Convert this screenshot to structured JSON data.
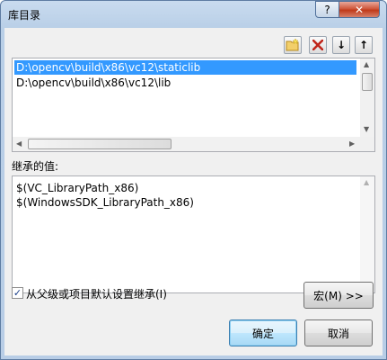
{
  "window": {
    "title": "库目录"
  },
  "titlebar_buttons": {
    "help": "?",
    "close": "✕"
  },
  "toolbar": {
    "new_line_icon": "folder-star-icon",
    "delete_icon": "delete-x-icon",
    "down_icon": "↓",
    "up_icon": "↑"
  },
  "directories": {
    "items": [
      {
        "path": "D:\\opencv\\build\\x86\\vc12\\staticlib",
        "selected": true
      },
      {
        "path": "D:\\opencv\\build\\x86\\vc12\\lib",
        "selected": false
      }
    ]
  },
  "inherited": {
    "label": "继承的值:",
    "values": [
      "$(VC_LibraryPath_x86)",
      "$(WindowsSDK_LibraryPath_x86)"
    ]
  },
  "inherit_checkbox": {
    "label": "从父级或项目默认设置继承(I)",
    "checked": true,
    "mark": "✓"
  },
  "buttons": {
    "macro": "宏(M) >>",
    "ok": "确定",
    "cancel": "取消"
  },
  "colors": {
    "selection": "#3399ff",
    "close_button": "#c03a1a",
    "title_bar": "#b9cfe7"
  }
}
